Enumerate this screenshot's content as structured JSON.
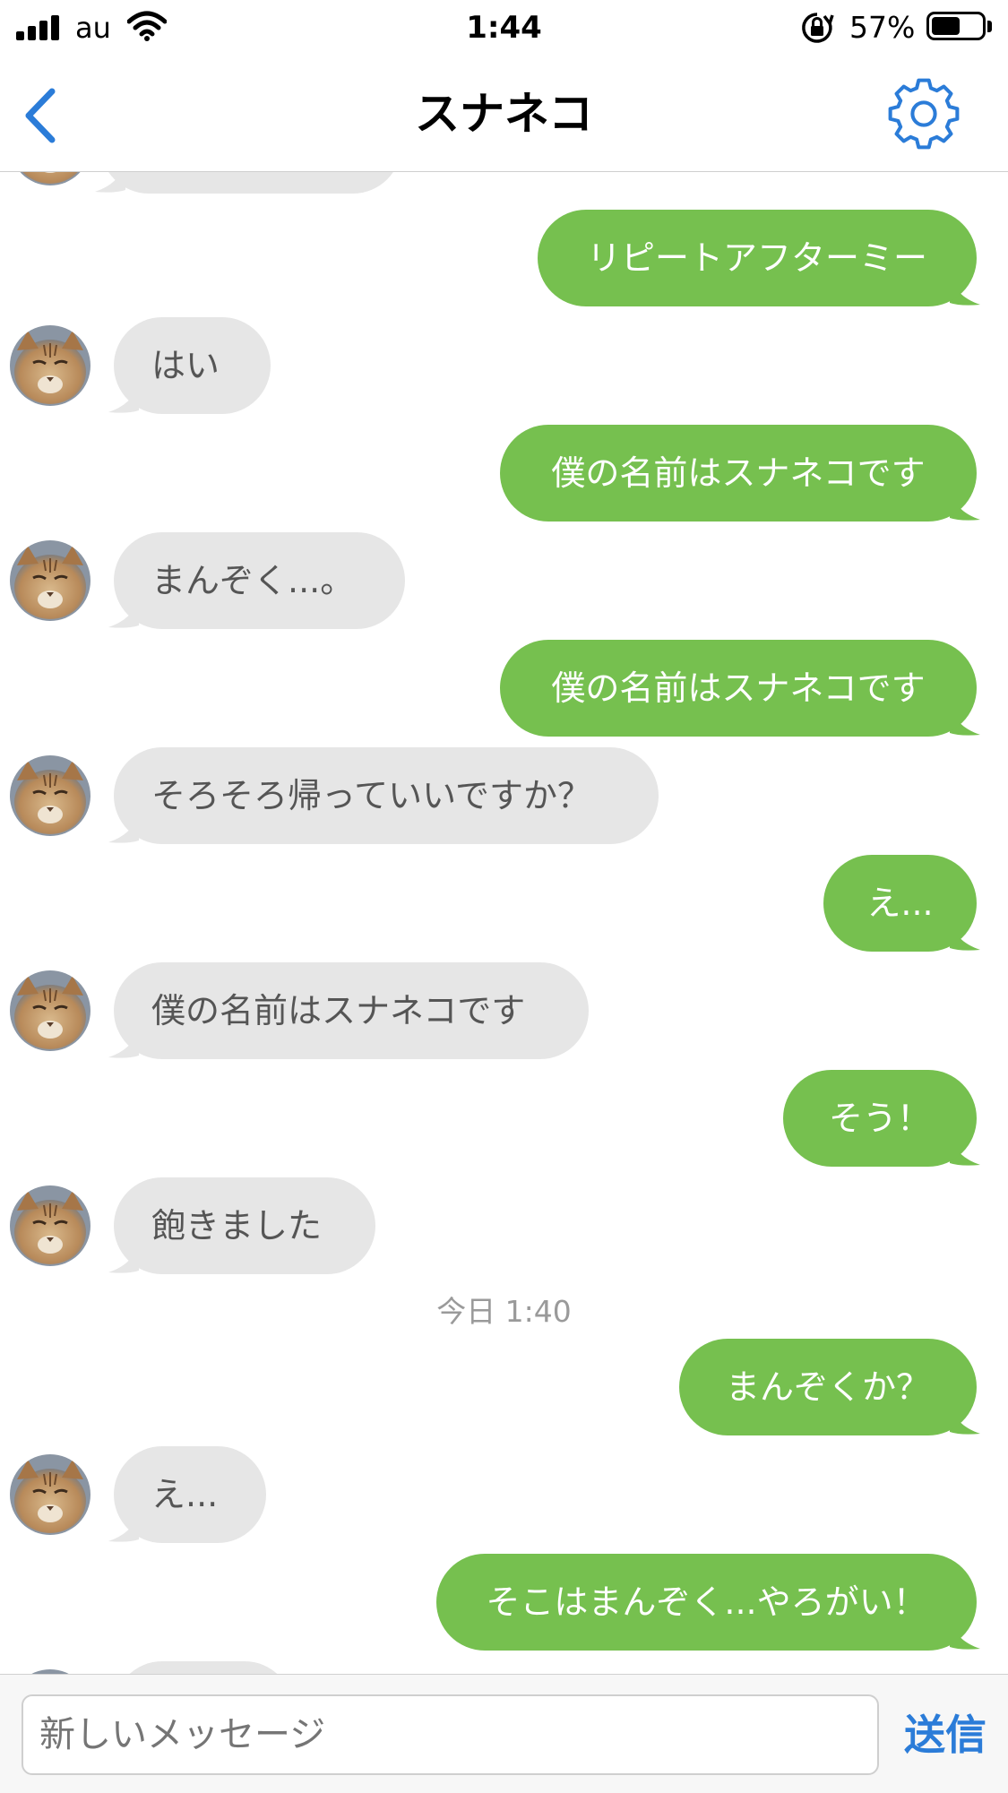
{
  "status_bar": {
    "carrier": "au",
    "time": "1:44",
    "battery_percent": "57%",
    "battery_level": 0.57
  },
  "nav": {
    "title": "スナネコ",
    "back_icon": "chevron-left-icon",
    "settings_icon": "gear-icon"
  },
  "colors": {
    "outgoing_bubble": "#76c04f",
    "incoming_bubble": "#e6e6e6",
    "accent": "#2b7cd8"
  },
  "messages": [
    {
      "dir": "in",
      "text": ""
    },
    {
      "dir": "out",
      "text": "リピートアフターミー"
    },
    {
      "dir": "in",
      "text": "はい"
    },
    {
      "dir": "out",
      "text": "僕の名前はスナネコです"
    },
    {
      "dir": "in",
      "text": "まんぞく...。"
    },
    {
      "dir": "out",
      "text": "僕の名前はスナネコです"
    },
    {
      "dir": "in",
      "text": "そろそろ帰っていいですか？"
    },
    {
      "dir": "out",
      "text": "え..."
    },
    {
      "dir": "in",
      "text": "僕の名前はスナネコです"
    },
    {
      "dir": "out",
      "text": "そう！"
    },
    {
      "dir": "in",
      "text": "飽きました"
    },
    {
      "dir": "out",
      "text": "まんぞくか？"
    },
    {
      "dir": "in",
      "text": "え..."
    },
    {
      "dir": "out",
      "text": "そこはまんぞく...やろがい！"
    },
    {
      "dir": "in",
      "text": ""
    }
  ],
  "timestamp": "今日 1:40",
  "composer": {
    "placeholder": "新しいメッセージ",
    "send_label": "送信"
  }
}
